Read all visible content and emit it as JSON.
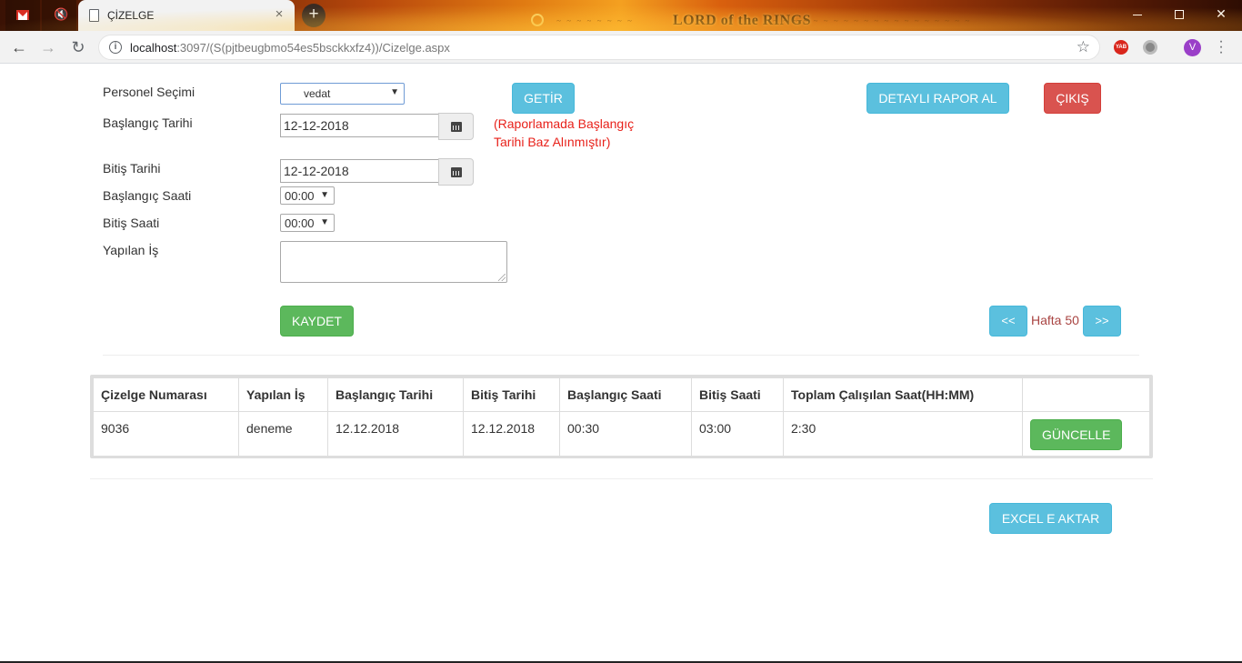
{
  "browser": {
    "tab_title": "ÇİZELGE",
    "tab_close": "×",
    "new_tab": "+",
    "theme_logo": "LORD of the RINGS",
    "url_host": "localhost",
    "url_rest": ":3097/(S(pjtbeugbmo54es5bsckkxfz4))/Cizelge.aspx",
    "ext_badge": "YAB",
    "profile_initial": "V",
    "icons": [
      "gmail-icon",
      "mute-icon",
      "page-icon",
      "back-icon",
      "forward-icon",
      "reload-icon",
      "info-icon",
      "star-icon",
      "avatar",
      "menu-icon"
    ]
  },
  "form": {
    "personel_label": "Personel Seçimi",
    "personel_value": "vedat",
    "start_date_label": "Başlangıç Tarihi",
    "start_date_value": "12-12-2018",
    "end_date_label": "Bitiş Tarihi",
    "end_date_value": "12-12-2018",
    "start_time_label": "Başlangıç Saati",
    "start_time_value": "00:00",
    "end_time_label": "Bitiş Saati",
    "end_time_value": "00:00",
    "work_label": "Yapılan İş",
    "work_value": "",
    "note_line1": "(Raporlamada Başlangıç",
    "note_line2": "Tarihi Baz Alınmıştır)"
  },
  "buttons": {
    "getir": "GETİR",
    "detayli": "DETAYLI RAPOR AL",
    "cikis": "ÇIKIŞ",
    "kaydet": "KAYDET",
    "prev": "<<",
    "next": ">>",
    "excel": "EXCEL E AKTAR"
  },
  "week": "Hafta 50",
  "table": {
    "headers": [
      "Çizelge Numarası",
      "Yapılan İş",
      "Başlangıç Tarihi",
      "Bitiş Tarihi",
      "Başlangıç Saati",
      "Bitiş Saati",
      "Toplam Çalışılan Saat(HH:MM)",
      ""
    ],
    "rows": [
      {
        "no": "9036",
        "is": "deneme",
        "bas_tarih": "12.12.2018",
        "bit_tarih": "12.12.2018",
        "bas_saat": "00:30",
        "bit_saat": "03:00",
        "toplam": "2:30",
        "action": "GÜNCELLE"
      }
    ]
  },
  "colors": {
    "info": "#5bc0de",
    "success": "#5cb85c",
    "danger": "#d9534f",
    "note_red": "#e8211a",
    "week_text": "#a94442"
  }
}
